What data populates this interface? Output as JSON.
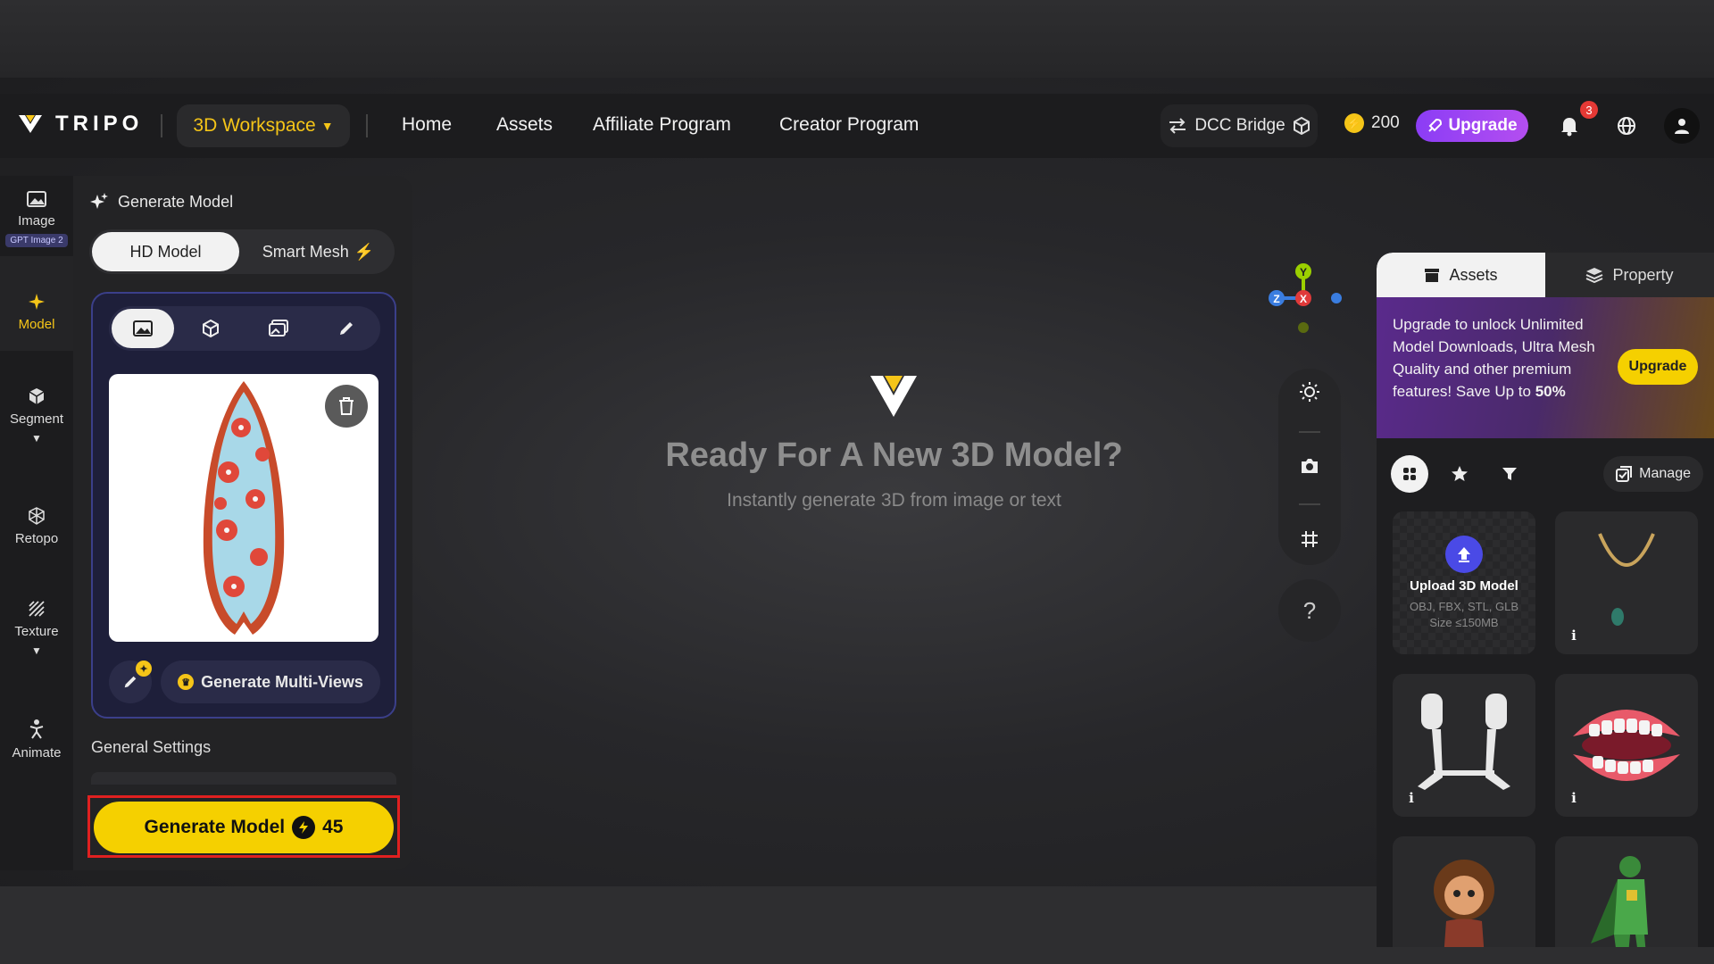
{
  "nav": {
    "logo_text": "TRIPO",
    "workspace_label": "3D Workspace",
    "links": [
      "Home",
      "Assets",
      "Affiliate Program",
      "Creator Program"
    ],
    "dcc_label": "DCC Bridge",
    "credits": "200",
    "upgrade_label": "Upgrade",
    "notification_count": "3"
  },
  "rail": {
    "items": [
      {
        "label": "Image",
        "badge": "GPT Image 2",
        "icon": "image-icon"
      },
      {
        "label": "Model",
        "icon": "sparkle-icon"
      },
      {
        "label": "Segment",
        "icon": "cube-icon"
      },
      {
        "label": "Retopo",
        "icon": "mesh-icon"
      },
      {
        "label": "Texture",
        "icon": "texture-icon"
      },
      {
        "label": "Animate",
        "icon": "figure-icon"
      }
    ]
  },
  "panel": {
    "title": "Generate Model",
    "tabs": [
      "HD Model",
      "Smart Mesh"
    ],
    "multi_views_label": "Generate Multi-Views",
    "settings_label": "General Settings",
    "generate_label": "Generate Model",
    "generate_cost": "45"
  },
  "center": {
    "title": "Ready For A New 3D Model?",
    "subtitle": "Instantly generate 3D from image or text"
  },
  "gizmo": {
    "y": "Y",
    "x": "X",
    "z": "Z"
  },
  "help_label": "?",
  "right": {
    "tabs": [
      "Assets",
      "Property"
    ],
    "promo_text_1": "Upgrade to unlock Unlimited Model Downloads, Ultra Mesh Quality and other premium features!  Save Up to ",
    "promo_highlight": "50%",
    "promo_button": "Upgrade",
    "manage_label": "Manage",
    "upload_title": "Upload 3D Model",
    "upload_formats": "OBJ, FBX, STL, GLB",
    "upload_size": "Size ≤150MB",
    "info_glyph": "i"
  },
  "colors": {
    "accent": "#f5d000",
    "upgrade": "#9b45f2",
    "highlight_border": "#e02020"
  }
}
